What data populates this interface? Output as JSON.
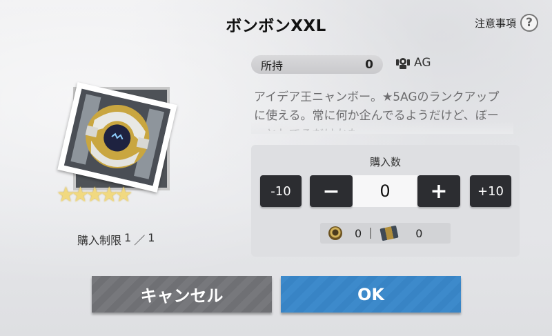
{
  "dialog": {
    "title": "ボンボンXXL",
    "notes_label": "注意事項",
    "help_glyph": "?"
  },
  "item": {
    "rarity_stars": 5,
    "star_glyph": "★",
    "limit_label": "購入制限",
    "limit_current": "1",
    "limit_separator": "／",
    "limit_max": "1"
  },
  "owned": {
    "label": "所持",
    "value": "0"
  },
  "category": {
    "label": "AG",
    "icon": "ag-robot-icon"
  },
  "description": "アイデア王ニャンボー。★5AGのランクアップに使える。常に何か企んでるようだけど、ぼーっとしてるだけかも。",
  "purchase": {
    "label": "購入数",
    "quantity": "0",
    "minus10_label": "-10",
    "minus_label": "−",
    "plus_label": "+",
    "plus10_label": "+10",
    "costs": [
      {
        "icon": "coin-icon",
        "value": "0"
      },
      {
        "icon": "ticket-icon",
        "value": "0"
      }
    ]
  },
  "buttons": {
    "cancel": "キャンセル",
    "ok": "OK"
  },
  "colors": {
    "ok_button": "#3d8acb",
    "cancel_button": "#77787c",
    "dark_button": "#2c2d31"
  }
}
